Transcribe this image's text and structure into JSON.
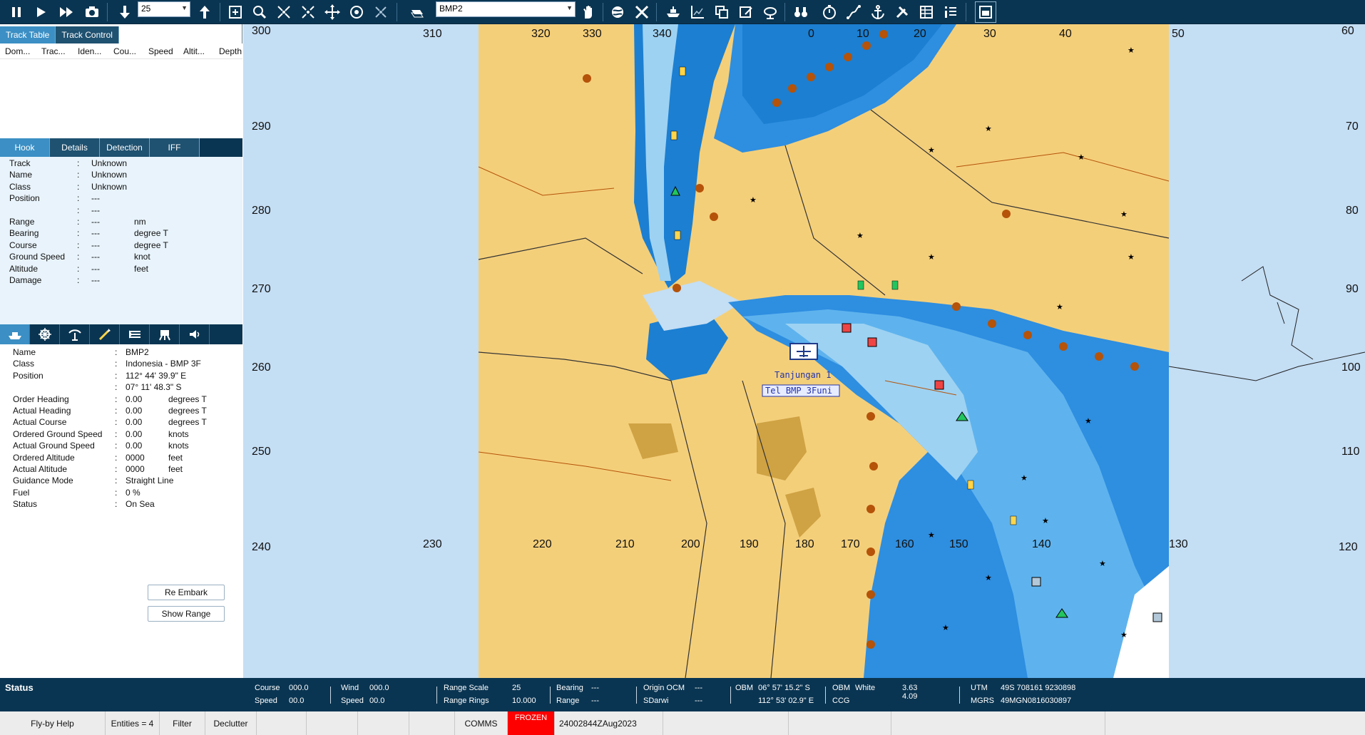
{
  "toolbar": {
    "time_factor": "25",
    "entity_select": "BMP2"
  },
  "track_tabs": [
    "Track Table",
    "Track Control"
  ],
  "track_table": {
    "columns": [
      "Dom...",
      "Trac...",
      "Iden...",
      "Cou...",
      "Speed",
      "Altit...",
      "Depth"
    ]
  },
  "hook_tabs": [
    "Hook",
    "Details",
    "Detection",
    "IFF"
  ],
  "hook": {
    "rows": [
      {
        "label": "Track",
        "value": "Unknown",
        "unit": ""
      },
      {
        "label": "Name",
        "value": "Unknown",
        "unit": ""
      },
      {
        "label": "Class",
        "value": "Unknown",
        "unit": ""
      },
      {
        "label": "Position",
        "value": "---",
        "unit": ""
      },
      {
        "label": "",
        "value": "---",
        "unit": ""
      },
      {
        "label": "Range",
        "value": "---",
        "unit": "nm"
      },
      {
        "label": "Bearing",
        "value": "---",
        "unit": "degree T"
      },
      {
        "label": "Course",
        "value": "---",
        "unit": "degree T"
      },
      {
        "label": "Ground Speed",
        "value": "---",
        "unit": "knot"
      },
      {
        "label": "Altitude",
        "value": "---",
        "unit": "feet"
      },
      {
        "label": "Damage",
        "value": "---",
        "unit": ""
      }
    ]
  },
  "entity": {
    "rows": [
      {
        "label": "Name",
        "value": "BMP2",
        "unit": ""
      },
      {
        "label": "Class",
        "value": "Indonesia - BMP 3F",
        "unit": ""
      },
      {
        "label": "Position",
        "value": "112° 44' 39.9\" E",
        "unit": ""
      },
      {
        "label": "",
        "value": "07° 11' 48.3\" S",
        "unit": ""
      },
      {
        "label": "Order Heading",
        "value": "0.00",
        "unit": "degrees T"
      },
      {
        "label": "Actual Heading",
        "value": "0.00",
        "unit": "degrees T"
      },
      {
        "label": "Actual Course",
        "value": "0.00",
        "unit": "degrees T"
      },
      {
        "label": "Ordered Ground Speed",
        "value": "0.00",
        "unit": "knots"
      },
      {
        "label": "Actual Ground Speed",
        "value": "0.00",
        "unit": "knots"
      },
      {
        "label": "Ordered Altitude",
        "value": "0000",
        "unit": "feet"
      },
      {
        "label": "Actual Altitude",
        "value": "0000",
        "unit": "feet"
      },
      {
        "label": "Guidance Mode",
        "value": "Straight Line",
        "unit": ""
      },
      {
        "label": "Fuel",
        "value": "0 %",
        "unit": ""
      },
      {
        "label": "Status",
        "value": "On Sea",
        "unit": ""
      }
    ],
    "re_embark_label": "Re Embark",
    "show_range_label": "Show Range"
  },
  "map": {
    "range_ring_labels": [
      "300",
      "310",
      "320",
      "330",
      "340",
      "0",
      "10",
      "20",
      "30",
      "40",
      "50",
      "60",
      "290",
      "70",
      "280",
      "80",
      "270",
      "90",
      "260",
      "100",
      "250",
      "110",
      "240",
      "230",
      "220",
      "210",
      "200",
      "190",
      "180",
      "170",
      "160",
      "150",
      "140",
      "130",
      "120"
    ],
    "unit_labels": [
      "Tanjungan 1",
      "Tel BMP 3Funi"
    ]
  },
  "status": {
    "title": "Status",
    "course_label": "Course",
    "course_value": "000.0",
    "speed_label": "Speed",
    "speed_value": "00.0",
    "wind_label": "Wind",
    "wind_value": "000.0",
    "wind_speed_label": "Speed",
    "wind_speed_value": "00.0",
    "range_scale_label": "Range Scale",
    "range_scale_value": "25",
    "range_rings_label": "Range Rings",
    "range_rings_value": "10.000",
    "bearing_label": "Bearing",
    "bearing_value": "---",
    "range_label": "Range",
    "range_value": "---",
    "origin_label": "Origin OCM",
    "origin_value": "---",
    "sdarwi_label": "SDarwi",
    "sdarwi_value": "---",
    "obm_label": "OBM",
    "obm_lat": "06° 57' 15.2\" S",
    "obm_lon": "112° 53' 02.9\" E",
    "obm2_label": "OBM",
    "obm2_value": "White",
    "ccg_label": "CCG",
    "val1": "3.63",
    "val2": "4.09",
    "utm_label": "UTM",
    "utm_value": "49S 708161 9230898",
    "mgrs_label": "MGRS",
    "mgrs_value": "49MGN0816030897"
  },
  "bottom": {
    "help": "Fly-by Help",
    "entities": "Entities = 4",
    "filter": "Filter",
    "declutter": "Declutter",
    "comms": "COMMS",
    "frozen": "FROZEN",
    "time": "24002844ZAug2023"
  }
}
